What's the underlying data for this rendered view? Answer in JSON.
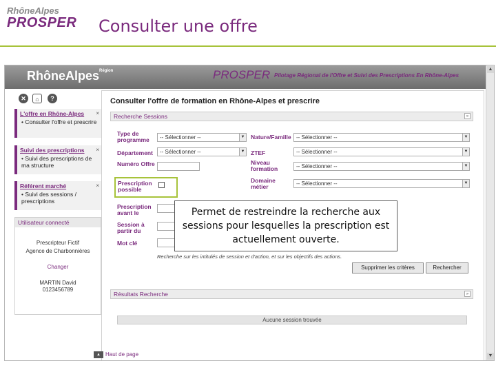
{
  "slide": {
    "logo_top": "RhôneAlpes",
    "logo_main": "PROSPER",
    "title": "Consulter une offre"
  },
  "colors": {
    "brand": "#7a2a7d",
    "accent": "#a7c33a",
    "banner": "#7a7a7a"
  },
  "app": {
    "logo": "RhôneAlpes",
    "logo_sup": "Région",
    "product": "PROSPER",
    "tagline": "Pilotage Régional de l'Offre et Suivi des Prescriptions En Rhône-Alpes"
  },
  "left_panel": {
    "buttons": [
      "x",
      "home",
      "?"
    ],
    "offer": {
      "title": "L'offre en Rhône-Alpes",
      "items": [
        "Consulter l'offre et prescrire"
      ]
    },
    "tracking": {
      "title": "Suivi des prescriptions",
      "items": [
        "Suivi des prescriptions de ma structure"
      ]
    },
    "market": {
      "title": "Référent marché",
      "items": [
        "Suivi des sessions / prescriptions"
      ]
    },
    "user": {
      "title": "Utilisateur connecté",
      "name": "Prescripteur Fictif",
      "agency": "Agence de Charbonnières",
      "change": "Changer",
      "person": "MARTIN David",
      "phone": "0123456789"
    }
  },
  "main": {
    "title": "Consulter l'offre de formation en Rhône-Alpes et prescrire",
    "search_box_title": "Recherche Sessions",
    "labels": {
      "type": "Type de programme",
      "nature": "Nature/Famille",
      "department": "Département",
      "ztef": "ZTEF",
      "offer_number": "Numéro Offre",
      "level": "Niveau formation",
      "prescription_possible": "Prescription possible",
      "domain": "Domaine métier",
      "prescription_before": "Prescription avant le",
      "session_from": "Session à partir du",
      "keyword": "Mot clé"
    },
    "select_placeholder": "-- Sélectionner --",
    "hint": "Recherche sur les intitulés de session et d'action, et sur les objectifs des actions.",
    "clear_button": "Supprimer les critères",
    "search_button": "Rechercher",
    "results_title": "Résultats Recherche",
    "results_empty": "Aucune session trouvée",
    "back_top": "Haut de page"
  },
  "callout": "Permet de restreindre la recherche aux sessions pour lesquelles la prescription est actuellement ouverte."
}
